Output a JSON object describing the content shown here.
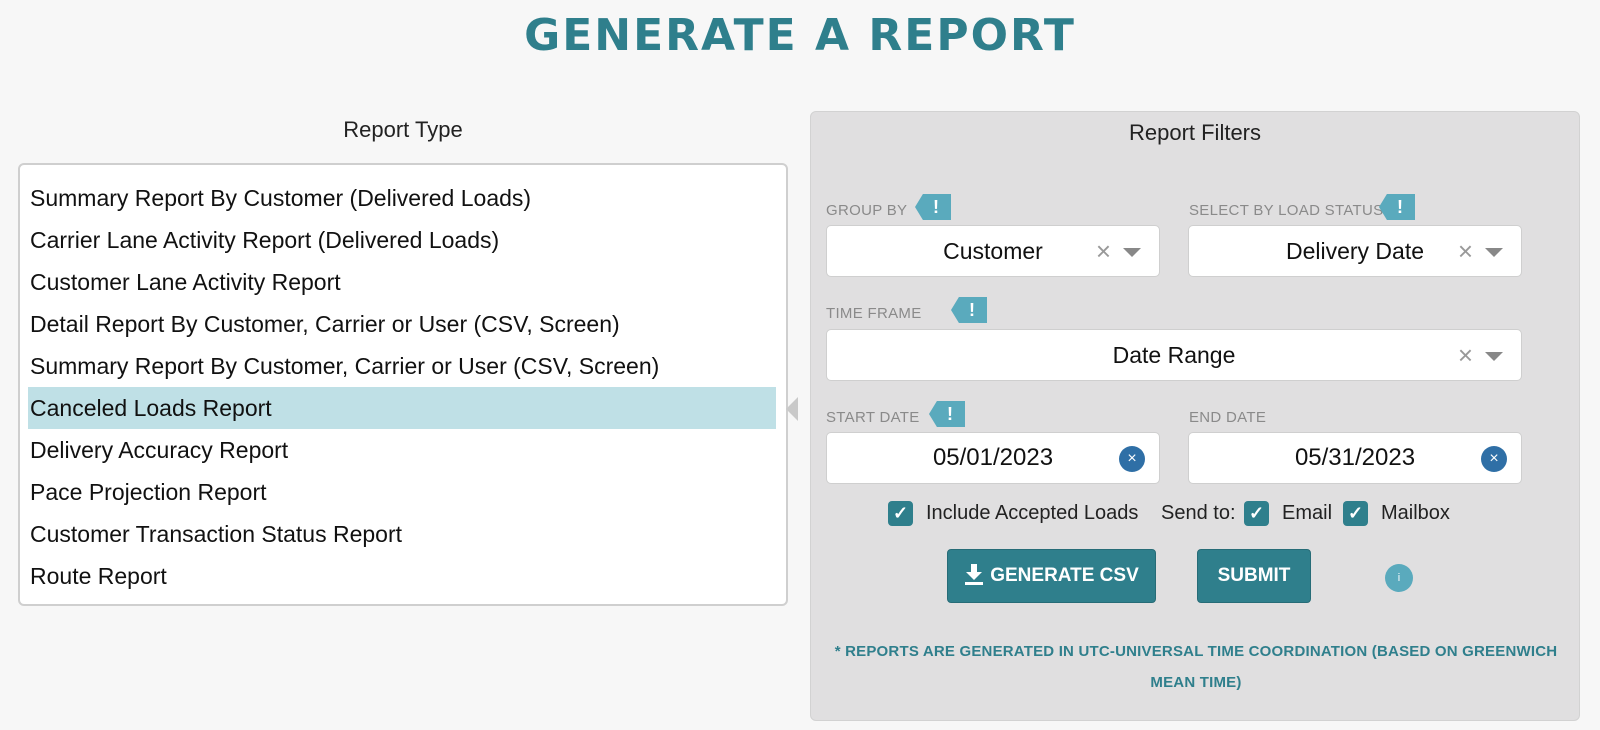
{
  "page": {
    "title": "GENERATE A REPORT"
  },
  "report_type": {
    "heading": "Report Type",
    "selected_index": 5,
    "items": [
      "Summary Report By Customer (Delivered Loads)",
      "Carrier Lane Activity Report (Delivered Loads)",
      "Customer Lane Activity Report",
      "Detail Report By Customer, Carrier or User (CSV, Screen)",
      "Summary Report By Customer, Carrier or User (CSV, Screen)",
      "Canceled Loads Report",
      "Delivery Accuracy Report",
      "Pace Projection Report",
      "Customer Transaction Status Report",
      "Route Report"
    ]
  },
  "filters": {
    "heading": "Report Filters",
    "flag_glyph": "!",
    "clear_glyph": "×",
    "group_by": {
      "label": "GROUP BY",
      "value": "Customer"
    },
    "load_status": {
      "label": "SELECT BY LOAD STATUS",
      "value": "Delivery Date"
    },
    "time_frame": {
      "label": "TIME FRAME",
      "value": "Date Range"
    },
    "start_date": {
      "label": "START DATE",
      "value": "05/01/2023"
    },
    "end_date": {
      "label": "END DATE",
      "value": "05/31/2023"
    },
    "include_accepted": {
      "label": "Include Accepted Loads",
      "checked": true
    },
    "send_to": {
      "label": "Send to:",
      "email": {
        "label": "Email",
        "checked": true
      },
      "mailbox": {
        "label": "Mailbox",
        "checked": true
      }
    },
    "check_glyph": "✓",
    "generate_csv_label": "GENERATE CSV",
    "submit_label": "SUBMIT",
    "info_glyph": "i",
    "footnote": "* REPORTS ARE GENERATED IN UTC-UNIVERSAL TIME COORDINATION (BASED ON GREENWICH MEAN TIME)"
  },
  "colors": {
    "accent": "#2f7f8c",
    "flag": "#5aaabd",
    "selected_row": "#bfe0e6",
    "date_clear": "#2f6fa6",
    "panel_bg": "#e0dfe0"
  }
}
